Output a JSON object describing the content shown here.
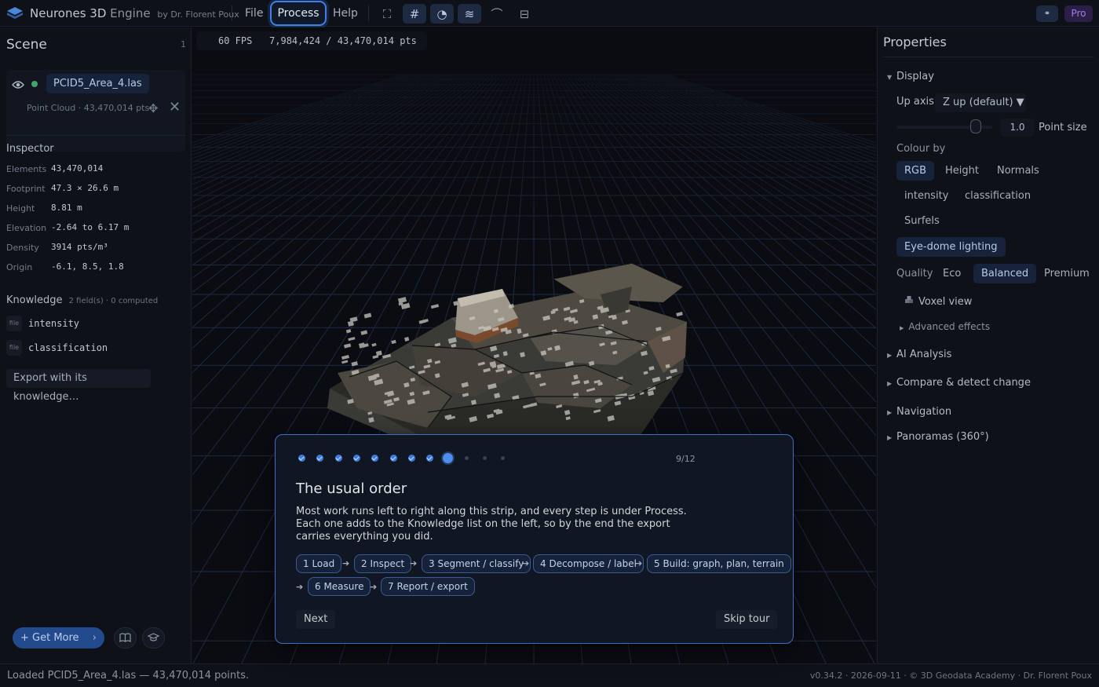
{
  "app": {
    "name": "Neurones 3D",
    "engine": "Engine",
    "by": "by Dr. Florent Poux",
    "pro": "Pro",
    "r_btn": "⚭"
  },
  "menu": {
    "file": "File",
    "process": "Process",
    "help": "Help"
  },
  "toolbar": {
    "expand": "⛶",
    "grid": "#",
    "orbit": "◔",
    "layers": "≋",
    "curve": "⌒",
    "stack": "⊟"
  },
  "scene": {
    "title": "Scene",
    "count": "1",
    "file": "PCID5_Area_4.las",
    "meta": "Point Cloud · 43,470,014 pts",
    "move": "✥",
    "close": "✕"
  },
  "inspector": {
    "title": "Inspector",
    "rows": [
      {
        "k": "Elements",
        "v": "43,470,014"
      },
      {
        "k": "Footprint",
        "v": "47.3 × 26.6 m"
      },
      {
        "k": "Height",
        "v": "8.81 m"
      },
      {
        "k": "Elevation",
        "v": "-2.64 to 6.17 m"
      },
      {
        "k": "Density",
        "v": "3914 pts/m³"
      },
      {
        "k": "Origin",
        "v": "-6.1, 8.5, 1.8"
      }
    ]
  },
  "knowledge": {
    "title": "Knowledge",
    "sub": "2 field(s) · 0 computed",
    "badge": "file",
    "fields": [
      "intensity",
      "classification"
    ],
    "export": "Export with its knowledge…"
  },
  "bottom_left": {
    "getmore": "+ Get More",
    "chev": "›",
    "book": "📖",
    "cap": "🎓"
  },
  "viewport": {
    "fps": "60 FPS   7,984,424 / 43,470,014 pts"
  },
  "properties": {
    "title": "Properties",
    "display": "Display",
    "up_axis_label": "Up axis",
    "up_axis_value": "Z up (default) ▼",
    "point_size_value": "1.0",
    "point_size_label": "Point size",
    "colour_by": "Colour by",
    "colour_opts": [
      "RGB",
      "Height",
      "Normals",
      "intensity",
      "classification",
      "Surfels"
    ],
    "edl": "Eye-dome lighting",
    "quality_label": "Quality",
    "quality_opts": [
      "Eco",
      "Balanced",
      "Premium"
    ],
    "voxel": "Voxel view",
    "advanced": "Advanced effects",
    "sections": [
      "AI Analysis",
      "Compare & detect change",
      "Navigation",
      "Panoramas (360°)"
    ],
    "tri_open": "▼",
    "tri_closed": "▶"
  },
  "tour": {
    "step_text": "9/12",
    "current_step": 9,
    "total_steps": 12,
    "title": "The usual order",
    "body": "Most work runs left to right along this strip, and every step is under Process. Each one adds to the Knowledge list on the left, so by the end the export carries everything you did.",
    "pipeline": [
      "1  Load",
      "2  Inspect",
      "3  Segment / classify",
      "4  Decompose / label",
      "5  Build: graph, plan, terrain",
      "6  Measure",
      "7  Report / export"
    ],
    "arrow": "➔",
    "next": "Next",
    "skip": "Skip tour"
  },
  "status": {
    "left": "Loaded PCID5_Area_4.las — 43,470,014 points.",
    "right": "v0.34.2 · 2026-09-11 · © 3D Geodata Academy · Dr. Florent Poux"
  },
  "colors": {
    "accent": "#3e7fe8",
    "panel": "#0e1118",
    "viewport": "#0a0c12",
    "grid": "#1f2a40"
  }
}
